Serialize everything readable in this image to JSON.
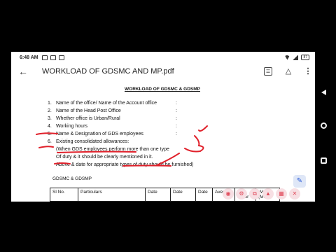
{
  "status": {
    "time": "6:48 AM",
    "battery": "87"
  },
  "app_bar": {
    "title": "WORKLOAD OF GDSMC AND MP.pdf"
  },
  "document": {
    "heading": "WORKLOAD OF GDSMC & GDSMP",
    "items": [
      {
        "num": "1.",
        "text": "Name of the office/ Name of the Account office"
      },
      {
        "num": "2.",
        "text": "Name of the Head Post Office"
      },
      {
        "num": "3.",
        "text": "Whether office is Urban/Rural"
      },
      {
        "num": "4.",
        "text": "Working hours"
      },
      {
        "num": "5.",
        "text": "Name & Designation of GDS employees"
      },
      {
        "num": "6.",
        "text": "Existing consolidated allowances:"
      }
    ],
    "colon": ":",
    "notes": [
      "(When GDS employees perform more than one type",
      "Of duty & it should be clearly mentioned in it.",
      "Above & date for appropriate types of duty should be furnished)"
    ],
    "sub_heading": "GDSMC & GDSMP",
    "table_headers": [
      "Sl No.",
      "Particulars",
      "Date",
      "Date",
      "Date",
      "Avera",
      "Ti",
      "Workin"
    ],
    "table_sub_headers": [
      "factor",
      "(Mts.)"
    ]
  },
  "icons": {
    "back": "arrow-left-icon",
    "page": "page-number-icon",
    "drive": "add-to-drive-icon",
    "more": "more-vert-icon",
    "edit": "pencil-icon"
  },
  "colors": {
    "ink": "#e0202a",
    "accent": "#2a5bd7",
    "toolbar_bg": "#f7dfe3"
  }
}
